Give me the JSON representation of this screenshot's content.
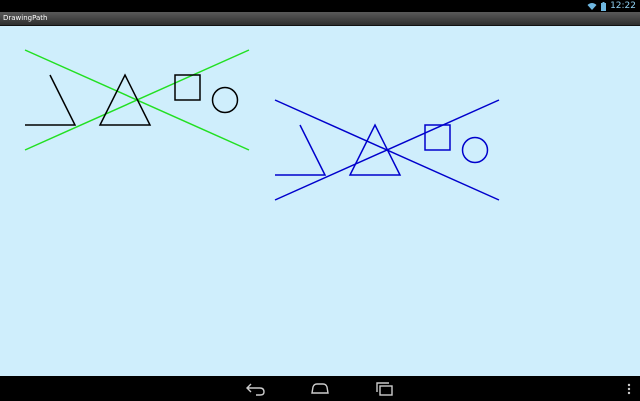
{
  "status_bar": {
    "time": "12:22",
    "icons": [
      "wifi-icon",
      "battery-icon"
    ],
    "text_color": "#8fd0f2"
  },
  "app": {
    "title": "DrawingPath"
  },
  "canvas": {
    "background": "#cfeefc",
    "groups": [
      {
        "name": "black-group",
        "color": "#000000",
        "shapes": [
          "angle-path",
          "triangle",
          "rectangle",
          "circle",
          "cross-lines"
        ],
        "cross_line_color": "#22e022"
      },
      {
        "name": "blue-group",
        "color": "#0000cc",
        "shapes": [
          "angle-path",
          "triangle",
          "rectangle",
          "circle",
          "cross-lines"
        ],
        "cross_line_color": "#0000cc"
      }
    ]
  },
  "nav_bar": {
    "buttons": [
      "back-icon",
      "home-icon",
      "recents-icon",
      "overflow-menu-icon"
    ],
    "icon_color": "#cccccc"
  }
}
